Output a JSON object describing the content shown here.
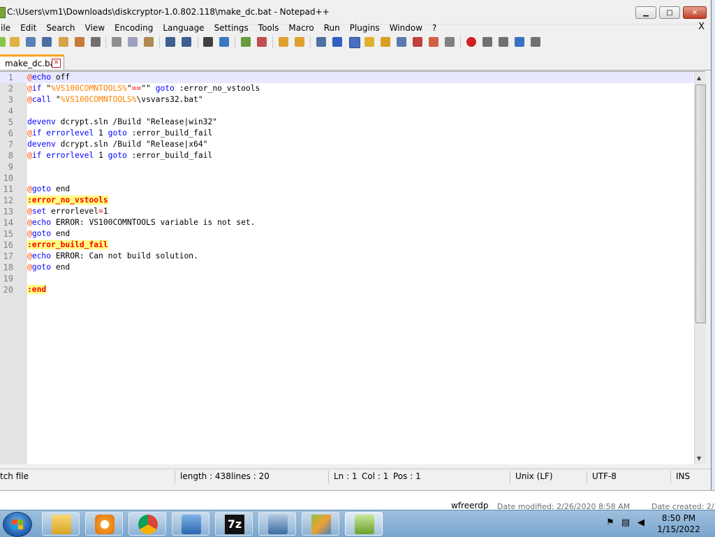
{
  "window": {
    "title": "C:\\Users\\vm1\\Downloads\\diskcryptor-1.0.802.118\\make_dc.bat - Notepad++",
    "min_glyph": "▁",
    "max_glyph": "□",
    "close_glyph": "✕"
  },
  "menu": {
    "items": [
      "ile",
      "Edit",
      "Search",
      "View",
      "Encoding",
      "Language",
      "Settings",
      "Tools",
      "Macro",
      "Run",
      "Plugins",
      "Window",
      "?"
    ],
    "close_label": "X"
  },
  "tab": {
    "label": "make_dc.bat",
    "close_glyph": "✕"
  },
  "status": {
    "file_type": "tch file",
    "length": "length : 438",
    "lines": "lines : 20",
    "ln": "Ln : 1",
    "col": "Col : 1",
    "pos": "Pos : 1",
    "eol": "Unix (LF)",
    "encoding": "UTF-8",
    "mode": "INS"
  },
  "explorer": {
    "name": "wfreerdp",
    "modified": "Date modified: 2/26/2020 8:58 AM",
    "created": "Date created: 2/2"
  },
  "taskbar": {
    "time": "8:50 PM",
    "date": "1/15/2022",
    "sevenzip_label": "7z"
  },
  "colors": {
    "tab_accent": "#f6a51f",
    "keyword": "#0000ff",
    "variable": "#ff8000",
    "label_bg": "#ffff80",
    "label_fg": "#ff0000"
  }
}
